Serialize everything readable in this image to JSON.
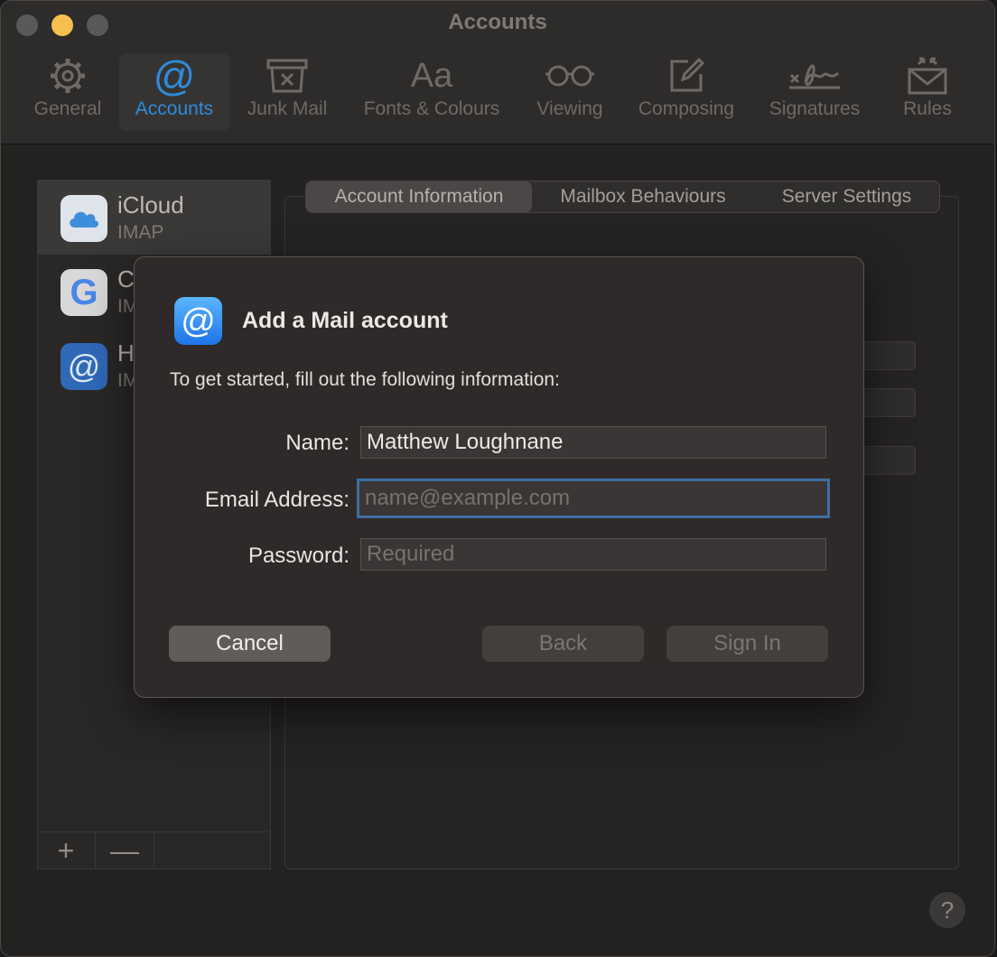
{
  "window": {
    "title": "Accounts"
  },
  "toolbar": {
    "items": [
      {
        "label": "General",
        "icon": "gear-icon"
      },
      {
        "label": "Accounts",
        "icon": "at-icon"
      },
      {
        "label": "Junk Mail",
        "icon": "junk-mail-icon"
      },
      {
        "label": "Fonts & Colours",
        "icon": "fonts-icon"
      },
      {
        "label": "Viewing",
        "icon": "glasses-icon"
      },
      {
        "label": "Composing",
        "icon": "compose-icon"
      },
      {
        "label": "Signatures",
        "icon": "signature-icon"
      },
      {
        "label": "Rules",
        "icon": "rules-icon"
      }
    ],
    "selected": "Accounts"
  },
  "accounts": {
    "items": [
      {
        "name": "iCloud",
        "type": "IMAP"
      },
      {
        "name": "C",
        "type": "IM"
      },
      {
        "name": "H",
        "type": "IM"
      }
    ],
    "footer": {
      "add": "+",
      "remove": "—"
    }
  },
  "tabs": {
    "items": [
      "Account Information",
      "Mailbox Behaviours",
      "Server Settings"
    ],
    "active": "Account Information"
  },
  "help": {
    "label": "?"
  },
  "dialog": {
    "title": "Add a Mail account",
    "subtitle": "To get started, fill out the following information:",
    "fields": {
      "name": {
        "label": "Name:",
        "value": "Matthew Loughnane"
      },
      "email": {
        "label": "Email Address:",
        "placeholder": "name@example.com"
      },
      "password": {
        "label": "Password:",
        "placeholder": "Required"
      }
    },
    "buttons": {
      "cancel": "Cancel",
      "back": "Back",
      "sign_in": "Sign In"
    }
  },
  "colors": {
    "accent": "#2e8bd9",
    "window_bg": "#242221",
    "dialog_bg": "#2f2a29",
    "focus_ring": "#3d6ea3"
  }
}
